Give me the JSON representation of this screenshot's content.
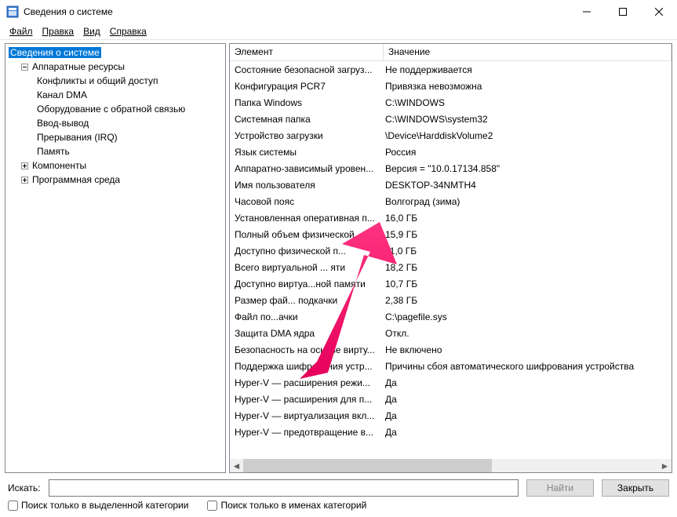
{
  "window": {
    "title": "Сведения о системе"
  },
  "menu": {
    "file": "Файл",
    "edit": "Правка",
    "view": "Вид",
    "help": "Справка"
  },
  "tree": {
    "root": "Сведения о системе",
    "hardware": "Аппаратные ресурсы",
    "hw_children": {
      "conflicts": "Конфликты и общий доступ",
      "dma": "Канал DMA",
      "feedback_hw": "Оборудование с обратной связью",
      "io": "Ввод-вывод",
      "irq": "Прерывания (IRQ)",
      "memory": "Память"
    },
    "components": "Компоненты",
    "software_env": "Программная среда"
  },
  "list": {
    "col_element": "Элемент",
    "col_value": "Значение",
    "rows": [
      {
        "el": "Состояние безопасной загруз...",
        "val": "Не поддерживается"
      },
      {
        "el": "Конфигурация PCR7",
        "val": "Привязка невозможна"
      },
      {
        "el": "Папка Windows",
        "val": "C:\\WINDOWS"
      },
      {
        "el": "Системная папка",
        "val": "C:\\WINDOWS\\system32"
      },
      {
        "el": "Устройство загрузки",
        "val": "\\Device\\HarddiskVolume2"
      },
      {
        "el": "Язык системы",
        "val": "Россия"
      },
      {
        "el": "Аппаратно-зависимый уровен...",
        "val": "Версия = \"10.0.17134.858\""
      },
      {
        "el": "Имя пользователя",
        "val": "DESKTOP-34NMTH4"
      },
      {
        "el": "Часовой пояс",
        "val": "Волгоград (зима)"
      },
      {
        "el": "Установленная оперативная п...",
        "val": "16,0 ГБ"
      },
      {
        "el": "Полный объем физической ...",
        "val": "15,9 ГБ"
      },
      {
        "el": "Доступно физической п...",
        "val": "11,0 ГБ"
      },
      {
        "el": "Всего виртуальной ... яти",
        "val": "18,2 ГБ"
      },
      {
        "el": "Доступно виртуа...ной памяти",
        "val": "10,7 ГБ"
      },
      {
        "el": "Размер фай... подкачки",
        "val": "2,38 ГБ"
      },
      {
        "el": "Файл по...ачки",
        "val": "C:\\pagefile.sys"
      },
      {
        "el": "Защита DMA ядра",
        "val": "Откл."
      },
      {
        "el": "Безопасность на основе вирту...",
        "val": "Не включено"
      },
      {
        "el": "Поддержка шифрования устр...",
        "val": "Причины сбоя автоматического шифрования устройства"
      },
      {
        "el": "Hyper-V — расширения режи...",
        "val": "Да"
      },
      {
        "el": "Hyper-V — расширения для п...",
        "val": "Да"
      },
      {
        "el": "Hyper-V — виртуализация вкл...",
        "val": "Да"
      },
      {
        "el": "Hyper-V — предотвращение в...",
        "val": "Да"
      }
    ]
  },
  "search": {
    "label": "Искать:",
    "value": "",
    "find_btn": "Найти",
    "close_btn": "Закрыть",
    "chk_selected_cat": "Поиск только в выделенной категории",
    "chk_names_only": "Поиск только в именах категорий"
  }
}
